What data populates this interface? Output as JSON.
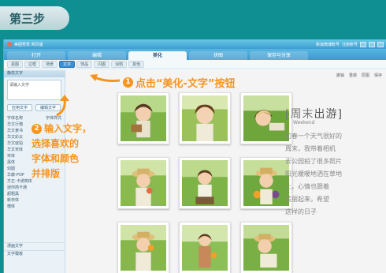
{
  "step": {
    "label": "第三步"
  },
  "window": {
    "title": "美图秀秀 网页版",
    "right_links": [
      "新浪微博账号",
      "注册账号"
    ]
  },
  "tabs": [
    {
      "label": "打开"
    },
    {
      "label": "编辑"
    },
    {
      "label": "美化",
      "active": true
    },
    {
      "label": "拼图"
    },
    {
      "label": "保存与分享"
    }
  ],
  "toolbar": {
    "items": [
      "抠图",
      "边框",
      "场景",
      "文字",
      "饰品",
      "闪图",
      "涂鸦",
      "其他"
    ],
    "active_index": 3
  },
  "sidebar": {
    "header": "静态文字",
    "input_value": "请输入文字",
    "apply_label": "应用文字",
    "edit_label": "编辑文字",
    "list_header_left": "字体名称",
    "list_header_right": "字体样式",
    "fonts": [
      "华文行楷",
      "华文隶书",
      "华文彩云",
      "华文琥珀",
      "华文宋体",
      "宋体",
      "黑体",
      "幼圆",
      "华康-POP",
      "方正-卡通简体",
      "迷你简卡通",
      "超粗黑",
      "新宋体",
      "楷体"
    ],
    "section_2": "漫画文字",
    "section_3": "文字模板"
  },
  "canvas_tools": [
    "撤销",
    "重做",
    "原图",
    "保存"
  ],
  "annotations": {
    "a1_num": "1",
    "a1_text": "点击“美化-文字”按钮",
    "a2_num": "2",
    "a2_lines": [
      "输入文字，",
      "选择喜欢的",
      "字体和颜色",
      "并排版"
    ]
  },
  "weekend": {
    "title_left": "[周末",
    "title_right": "出游]",
    "subtitle": "Weekend",
    "lines": [
      "初春一个天气很好的",
      "周末，我带着相机",
      "去公园拍了很多照片",
      "阳光暖暖地洒在草地",
      "上，心情也跟着",
      "美丽起来，希望",
      "这样的日子"
    ]
  }
}
